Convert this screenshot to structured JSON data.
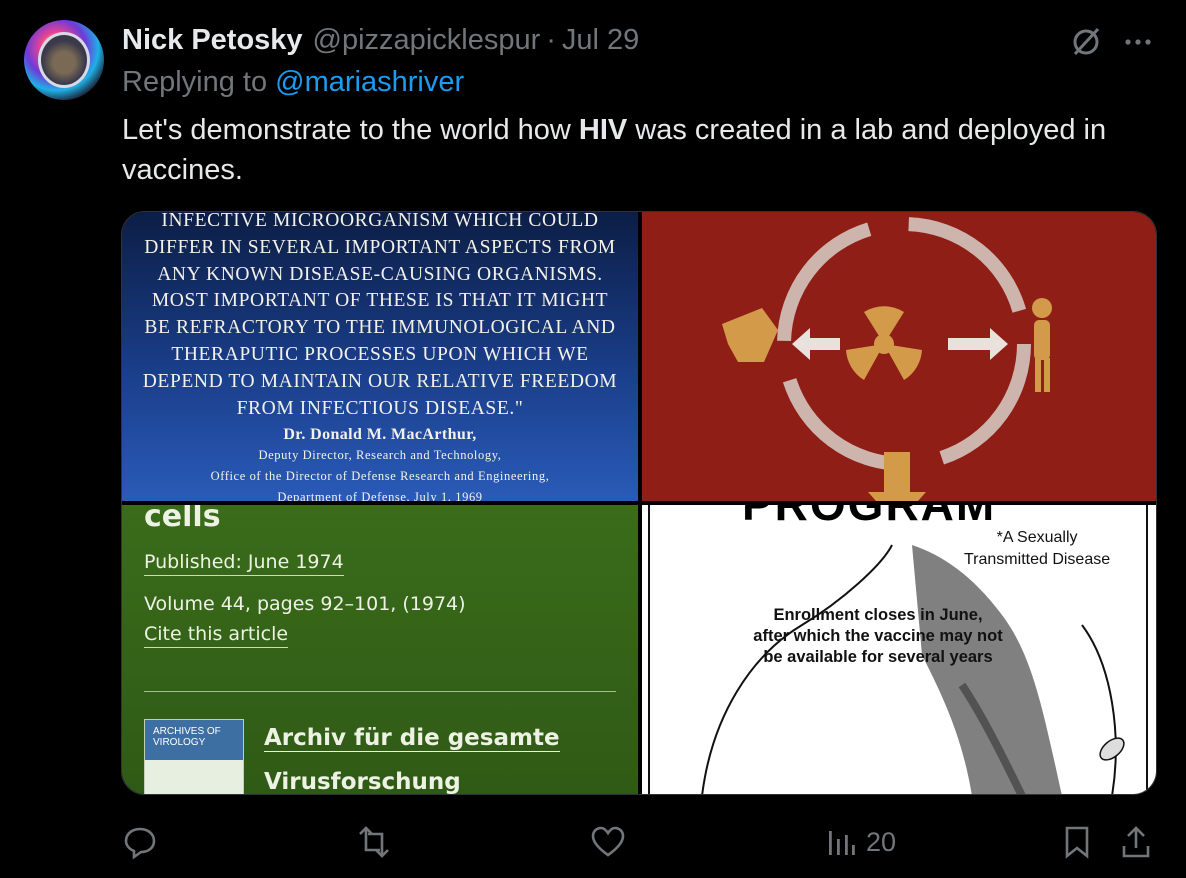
{
  "tweet": {
    "author_name": "Nick Petosky",
    "handle": "@pizzapicklespur",
    "separator": "·",
    "date": "Jul 29",
    "replying_prefix": "Replying to ",
    "replying_to": "@mariashriver",
    "text_before": "Let's demonstrate to the world how ",
    "text_bold": "HIV",
    "text_after": " was created in a lab and deployed in vaccines."
  },
  "images": {
    "quote_card": {
      "lines": [
        "Infective microorganism which could",
        "differ in several important aspects from",
        "any known disease-causing organisms.",
        "Most important of these is that it might",
        "be refractory to the immunological and",
        "theraputic processes upon which we",
        "depend to maintain our relative freedom",
        "from infectious disease.\""
      ],
      "attribution_name": "Dr. Donald M. MacArthur,",
      "attribution_title": "Deputy Director, Research and Technology,",
      "attribution_office": "Office of the Director of Defense Research and Engineering,",
      "attribution_dept": "Department of Defense, July 1, 1969"
    },
    "article_card": {
      "heading": "cells",
      "published": "Published: June 1974",
      "volume": "Volume 44, pages 92–101, (1974)",
      "cite": "Cite this article",
      "book_label": "ARCHIVES OF VIROLOGY",
      "journal_line1": "Archiv für die gesamte",
      "journal_line2": "Virusforschung"
    },
    "poster_card": {
      "program": "PROGRAM",
      "std_line1": "*A Sexually",
      "std_line2": "Transmitted Disease",
      "enroll_line1": "Enrollment closes in June,",
      "enroll_line2": "after which the vaccine may not",
      "enroll_line3": "be available for several years"
    }
  },
  "actions": {
    "views": "20"
  },
  "colors": {
    "background": "#000000",
    "text": "#e7e9ea",
    "muted": "#71767b",
    "link": "#1d9bf0"
  }
}
